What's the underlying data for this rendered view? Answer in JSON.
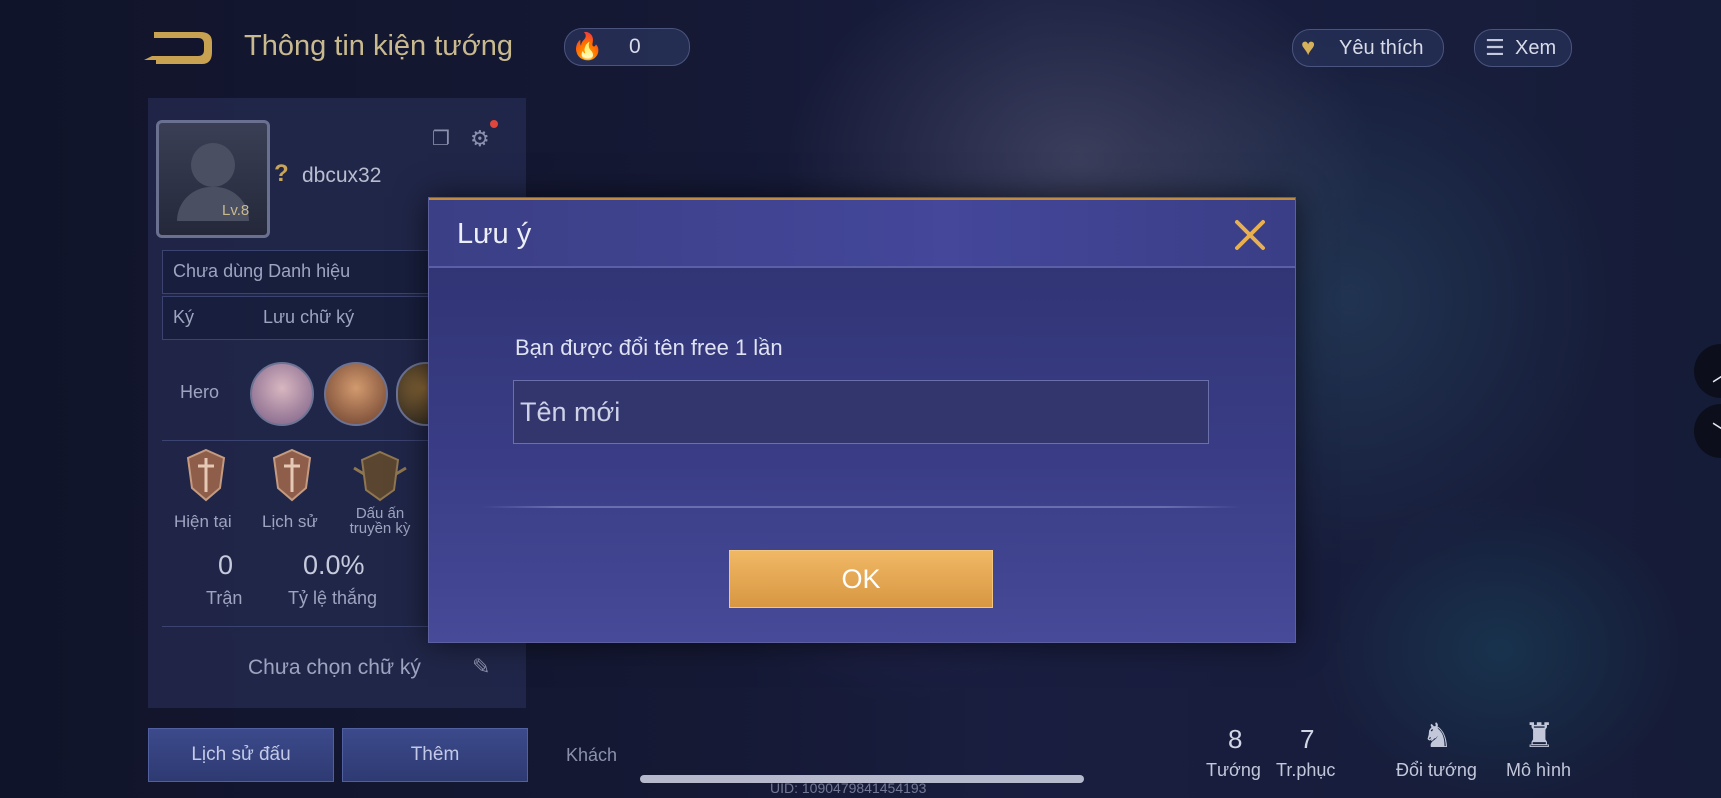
{
  "header": {
    "title": "Thông tin kiện tướng",
    "fire_value": "0",
    "favorite_label": "Yêu thích",
    "view_label": "Xem"
  },
  "profile": {
    "username": "dbcux32",
    "level": "Lv.8",
    "title_label": "Chưa dùng Danh hiệu",
    "signature_key": "Ký",
    "signature_value": "Lưu chữ ký",
    "hero_label": "Hero",
    "ranks": [
      "Hiện tại",
      "Lịch sử",
      "Dấu ấn\ntruyền kỳ"
    ],
    "stats": {
      "matches_value": "0",
      "matches_label": "Trận",
      "winrate_value": "0.0%",
      "winrate_label": "Tỷ lệ thắng"
    },
    "signature_prompt": "Chưa chọn chữ ký"
  },
  "tabs": {
    "history": "Lịch sử đấu",
    "more": "Thêm",
    "guest": "Khách"
  },
  "bottom_right": {
    "heroes_count": "8",
    "heroes_label": "Tướng",
    "skins_count": "7",
    "skins_label": "Tr.phục",
    "change_hero_label": "Đổi tướng",
    "model_label": "Mô hình"
  },
  "uid": "UID: 1090479841454193",
  "modal": {
    "title": "Lưu ý",
    "message": "Bạn được đổi tên free 1 lần",
    "input_placeholder": "Tên mới",
    "ok_label": "OK"
  },
  "colors": {
    "accent_gold": "#d89742",
    "modal_bg": "#3a3d86",
    "title_gold": "#c9b98f"
  }
}
